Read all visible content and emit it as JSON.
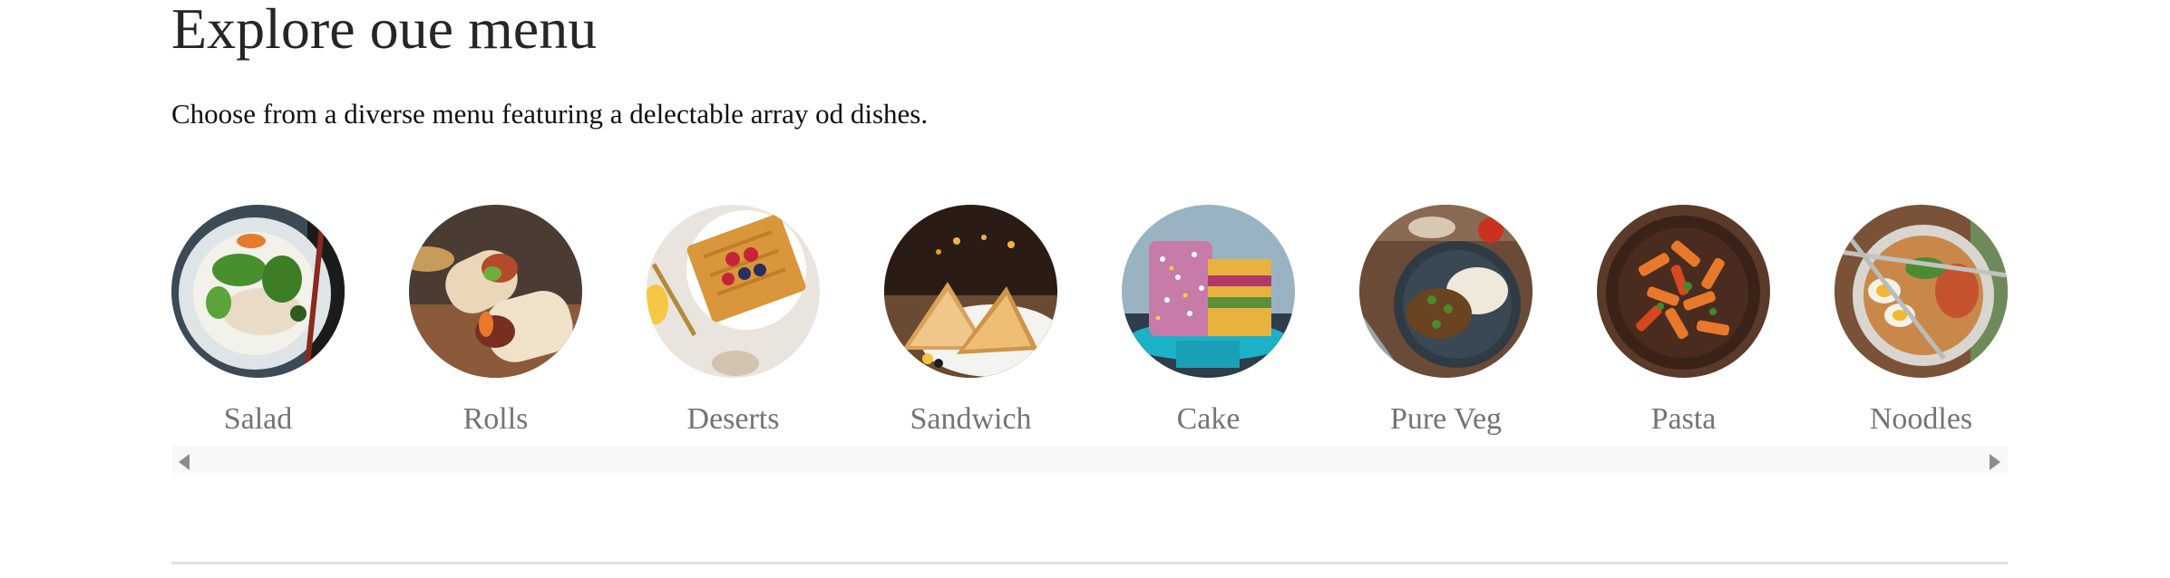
{
  "section": {
    "title": "Explore oue menu",
    "subtitle": "Choose from a diverse menu featuring a delectable array od dishes."
  },
  "menu_items": [
    {
      "label": "Salad",
      "image": "salad-bowl-photo"
    },
    {
      "label": "Rolls",
      "image": "wrap-rolls-photo"
    },
    {
      "label": "Deserts",
      "image": "waffle-berries-photo"
    },
    {
      "label": "Sandwich",
      "image": "toasted-sandwich-photo"
    },
    {
      "label": "Cake",
      "image": "sprinkle-cake-photo"
    },
    {
      "label": "Pure Veg",
      "image": "veg-curry-rice-photo"
    },
    {
      "label": "Pasta",
      "image": "penne-pasta-photo"
    },
    {
      "label": "Noodles",
      "image": "ramen-noodles-photo"
    }
  ],
  "scrollbar": {
    "left_icon": "arrow-left-icon",
    "right_icon": "arrow-right-icon"
  },
  "colors": {
    "title": "#262626",
    "label": "#747474",
    "scroll_track": "#f8f8f8",
    "scroll_arrow": "#8c8c8c",
    "divider": "#e2e2e2"
  }
}
